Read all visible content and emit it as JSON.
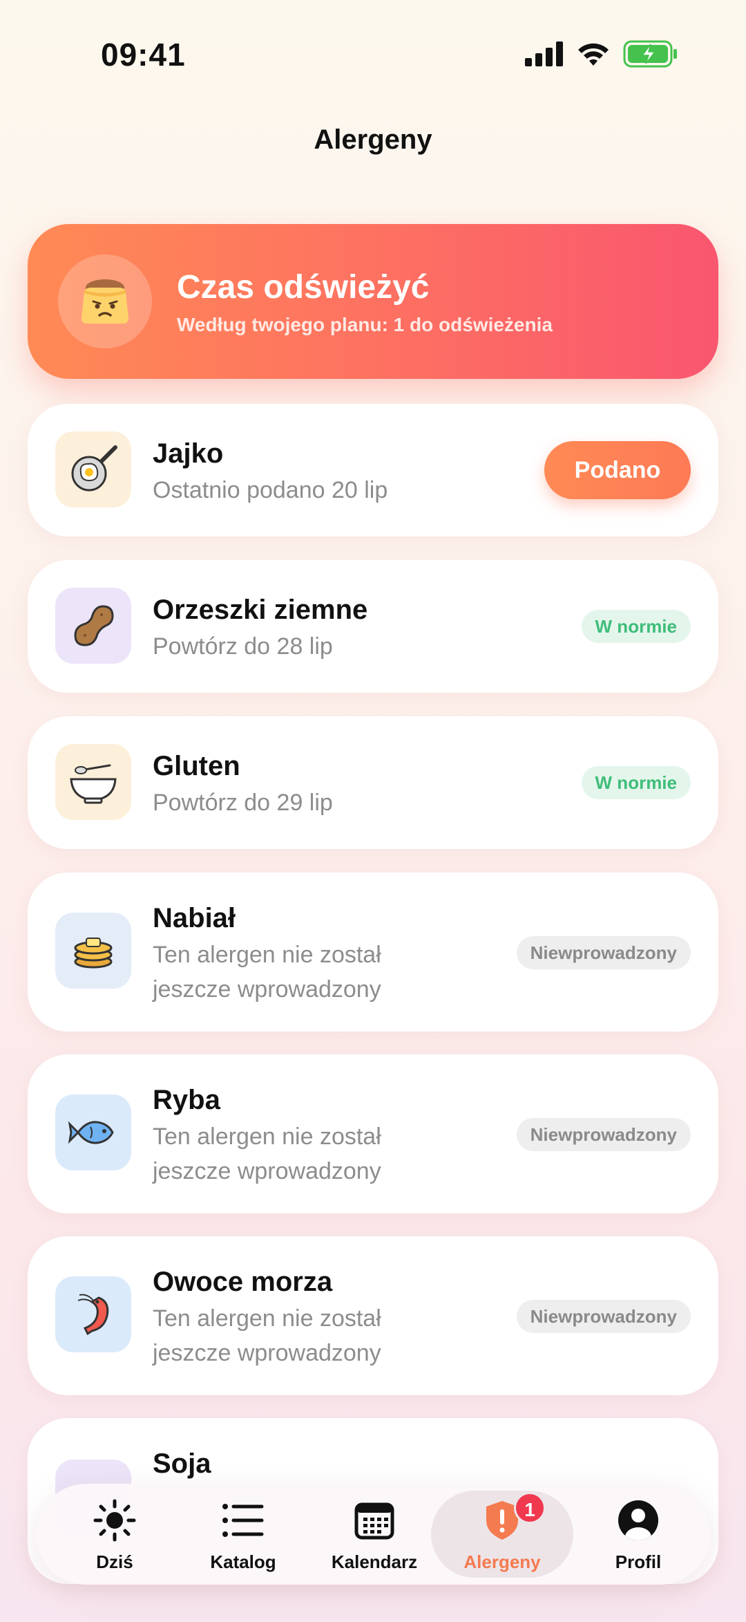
{
  "status_bar": {
    "time": "09:41"
  },
  "nav": {
    "title": "Alergeny"
  },
  "banner": {
    "title": "Czas odświeżyć",
    "subtitle": "Według twojego planu: 1 do odświeżenia"
  },
  "allergens": [
    {
      "name": "Jajko",
      "detail": "Ostatnio podano 20 lip",
      "action": "Podano",
      "icon": "fried-egg-pan-icon"
    },
    {
      "name": "Orzeszki ziemne",
      "detail": "Powtórz do 28 lip",
      "status": "W normie",
      "icon": "peanut-icon"
    },
    {
      "name": "Gluten",
      "detail": "Powtórz do 29 lip",
      "status": "W normie",
      "icon": "bowl-spoon-icon"
    },
    {
      "name": "Nabiał",
      "detail": "Ten alergen nie został jeszcze wprowadzony",
      "status": "Niewprowadzony",
      "icon": "butter-pancakes-icon"
    },
    {
      "name": "Ryba",
      "detail": "Ten alergen nie został jeszcze wprowadzony",
      "status": "Niewprowadzony",
      "icon": "fish-icon"
    },
    {
      "name": "Owoce morza",
      "detail": "Ten alergen nie został jeszcze wprowadzony",
      "status": "Niewprowadzony",
      "icon": "shrimp-icon"
    },
    {
      "name": "Soja",
      "icon": "soy-icon"
    }
  ],
  "tabs": [
    {
      "label": "Dziś",
      "icon": "sun-icon"
    },
    {
      "label": "Katalog",
      "icon": "list-icon"
    },
    {
      "label": "Kalendarz",
      "icon": "calendar-icon"
    },
    {
      "label": "Alergeny",
      "icon": "shield-alert-icon",
      "badge": "1",
      "active": true
    },
    {
      "label": "Profil",
      "icon": "profile-icon"
    }
  ],
  "colors": {
    "accent": "#f47a4f",
    "ok_text": "#3fbd7a",
    "ok_bg": "#e4f6ec",
    "badge": "#f0384f"
  }
}
